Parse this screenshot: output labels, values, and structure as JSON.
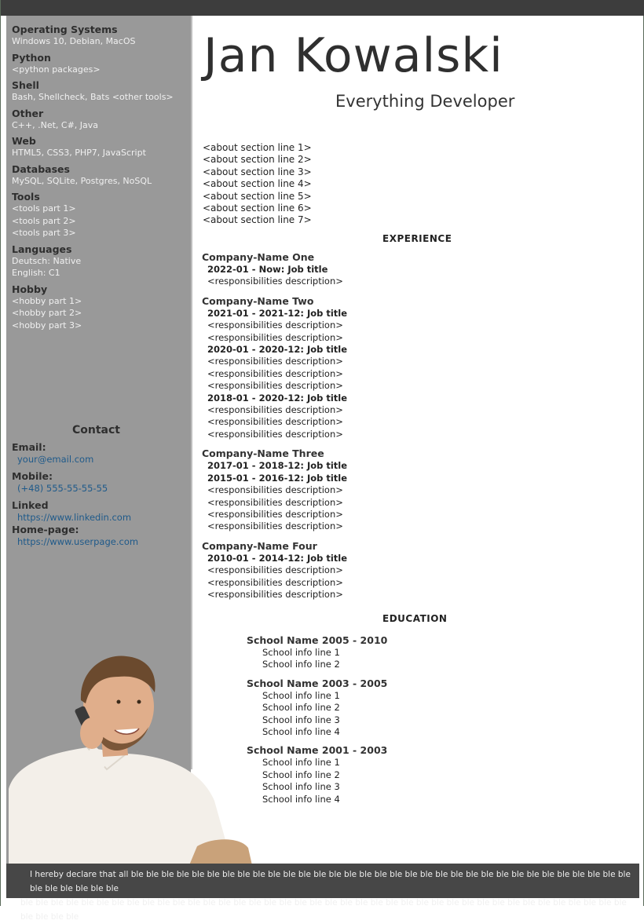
{
  "header": {
    "name": "Jan Kowalski",
    "role": "Everything Developer"
  },
  "sidebar": {
    "skills": [
      {
        "title": "Operating Systems",
        "lines": [
          "Windows 10, Debian, MacOS"
        ]
      },
      {
        "title": "Python",
        "lines": [
          "<python packages>"
        ]
      },
      {
        "title": "Shell",
        "lines": [
          "Bash, Shellcheck, Bats <other tools>"
        ]
      },
      {
        "title": "Other",
        "lines": [
          "C++, .Net, C#, Java"
        ]
      },
      {
        "title": "Web",
        "lines": [
          "HTML5, CSS3, PHP7, JavaScript"
        ]
      },
      {
        "title": "Databases",
        "lines": [
          "MySQL, SQLite, Postgres, NoSQL"
        ]
      },
      {
        "title": "Tools",
        "lines": [
          "<tools part 1>",
          "<tools part 2>",
          "<tools part 3>"
        ]
      },
      {
        "title": "Languages",
        "lines": [
          "Deutsch: Native",
          "English: C1"
        ]
      },
      {
        "title": "Hobby",
        "lines": [
          "<hobby part 1>",
          "<hobby part 2>",
          "<hobby part 3>"
        ]
      }
    ],
    "contact": {
      "title": "Contact",
      "email_label": "Email:",
      "email": "your@email.com",
      "mobile_label": "Mobile:",
      "mobile": "(+48) 555-55-55-55",
      "linked_label": "Linked",
      "linked": "https://www.linkedin.com",
      "home_label": "Home-page:",
      "home": "https://www.userpage.com"
    }
  },
  "about": [
    "<about section line 1>",
    "<about section line 2>",
    "<about section line 3>",
    "<about section line 4>",
    "<about section line 5>",
    "<about section line 6>",
    "<about section line 7>"
  ],
  "experience": {
    "heading": "EXPERIENCE",
    "companies": [
      {
        "name": "Company-Name One",
        "items": [
          {
            "t": "job",
            "text": "2022-01 - Now: Job title"
          },
          {
            "t": "resp",
            "text": "<responsibilities description>"
          }
        ]
      },
      {
        "name": "Company-Name Two",
        "items": [
          {
            "t": "job",
            "text": "2021-01 - 2021-12: Job title"
          },
          {
            "t": "resp",
            "text": "<responsibilities description>"
          },
          {
            "t": "resp",
            "text": "<responsibilities description>"
          },
          {
            "t": "job",
            "text": "2020-01 - 2020-12: Job title"
          },
          {
            "t": "resp",
            "text": "<responsibilities description>"
          },
          {
            "t": "resp",
            "text": "<responsibilities description>"
          },
          {
            "t": "resp",
            "text": "<responsibilities description>"
          },
          {
            "t": "job",
            "text": "2018-01 - 2020-12: Job title"
          },
          {
            "t": "resp",
            "text": "<responsibilities description>"
          },
          {
            "t": "resp",
            "text": "<responsibilities description>"
          },
          {
            "t": "resp",
            "text": "<responsibilities description>"
          }
        ]
      },
      {
        "name": "Company-Name Three",
        "items": [
          {
            "t": "job",
            "text": "2017-01 - 2018-12: Job title"
          },
          {
            "t": "job",
            "text": "2015-01 - 2016-12: Job title"
          },
          {
            "t": "resp",
            "text": "<responsibilities description>"
          },
          {
            "t": "resp",
            "text": "<responsibilities description>"
          },
          {
            "t": "resp",
            "text": "<responsibilities description>"
          },
          {
            "t": "resp",
            "text": "<responsibilities description>"
          }
        ]
      },
      {
        "name": "Company-Name Four",
        "items": [
          {
            "t": "job",
            "text": "2010-01 - 2014-12: Job title"
          },
          {
            "t": "resp",
            "text": "<responsibilities description>"
          },
          {
            "t": "resp",
            "text": "<responsibilities description>"
          },
          {
            "t": "resp",
            "text": "<responsibilities description>"
          }
        ]
      }
    ]
  },
  "education": {
    "heading": "EDUCATION",
    "schools": [
      {
        "name": "School Name 2005 - 2010",
        "lines": [
          "School info line 1",
          "School info line 2"
        ]
      },
      {
        "name": "School Name 2003 - 2005",
        "lines": [
          "School info line 1",
          "School info line 2",
          "School info line 3",
          "School info line 4"
        ]
      },
      {
        "name": "School Name 2001 - 2003",
        "lines": [
          "School info line 1",
          "School info line 2",
          "School info line 3",
          "School info line 4"
        ]
      }
    ]
  },
  "footer": {
    "line1": "I hereby declare that all ble ble ble ble ble ble ble ble ble ble ble ble ble ble ble ble ble ble ble ble ble ble ble ble ble ble ble ble ble ble ble ble ble ble ble ble ble ble ble",
    "line2": "ble ble ble ble ble ble ble ble ble ble ble ble ble ble ble ble ble ble ble ble ble ble ble ble ble ble ble ble ble ble ble ble ble ble ble ble ble ble ble ble ble ble ble ble"
  }
}
